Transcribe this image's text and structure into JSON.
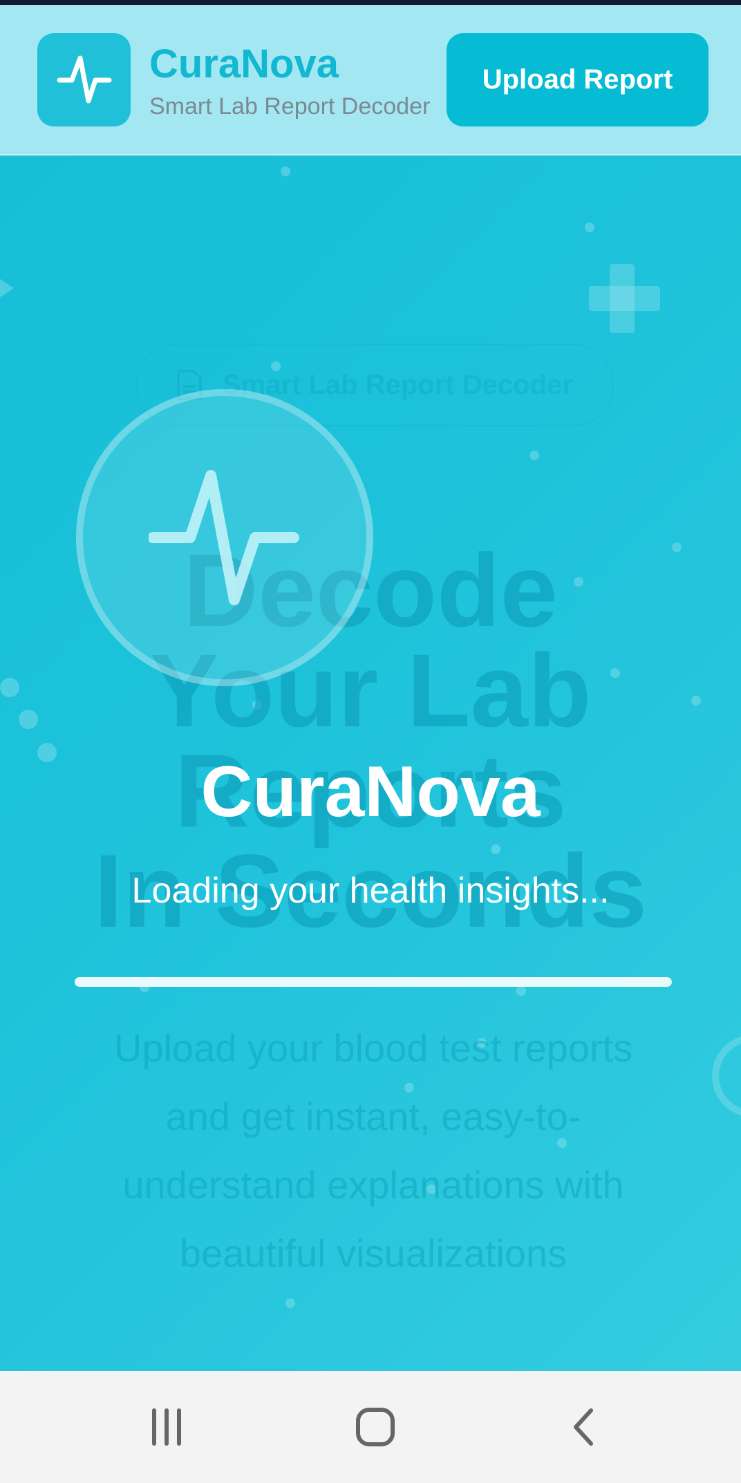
{
  "header": {
    "brand_title": "CuraNova",
    "brand_subtitle": "Smart Lab Report Decoder",
    "upload_button": "Upload Report",
    "logo_icon": "pulse-icon"
  },
  "hero_background": {
    "badge_text": "Smart Lab Report Decoder",
    "badge_icon": "document-icon",
    "heading_lines": [
      "Decode",
      "Your Lab",
      "Reports",
      "In Seconds"
    ],
    "paragraph": "Upload your blood test reports and get instant, easy-to-understand explanations with beautiful visualizations"
  },
  "loader": {
    "title": "CuraNova",
    "subtitle": "Loading your health insights...",
    "icon": "pulse-icon",
    "progress_fraction": 1.0
  },
  "navbar": {
    "items": [
      "recent-apps-icon",
      "home-icon",
      "back-icon"
    ]
  },
  "colors": {
    "accent": "#06bcd4",
    "header_bg": "#a3e7f2",
    "hero_bg": "#1fc3da"
  }
}
